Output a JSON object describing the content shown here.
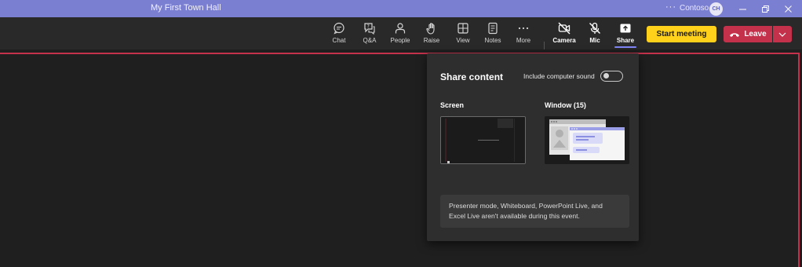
{
  "window": {
    "title": "My First Town Hall",
    "more": "···",
    "org": "Contoso",
    "avatar_initials": "CH"
  },
  "toolbar": {
    "items": [
      {
        "label": "Chat",
        "icon": "chat-icon"
      },
      {
        "label": "Q&A",
        "icon": "qna-icon"
      },
      {
        "label": "People",
        "icon": "people-icon"
      },
      {
        "label": "Raise",
        "icon": "raise-hand-icon"
      },
      {
        "label": "View",
        "icon": "view-icon"
      },
      {
        "label": "Notes",
        "icon": "notes-icon"
      },
      {
        "label": "More",
        "icon": "more-icon"
      },
      {
        "label": "Camera",
        "icon": "camera-off-icon"
      },
      {
        "label": "Mic",
        "icon": "mic-off-icon"
      },
      {
        "label": "Share",
        "icon": "share-icon"
      }
    ],
    "start_label": "Start meeting",
    "leave_label": "Leave"
  },
  "share_panel": {
    "heading": "Share content",
    "sound_label": "Include computer sound",
    "sound_on": false,
    "screen_label": "Screen",
    "window_label": "Window (15)",
    "notice": "Presenter mode, Whiteboard, PowerPoint Live, and Excel Live aren't available during this event."
  },
  "colors": {
    "accent": "#7b7fd1",
    "start": "#ffd11a",
    "leave": "#c4314b"
  }
}
